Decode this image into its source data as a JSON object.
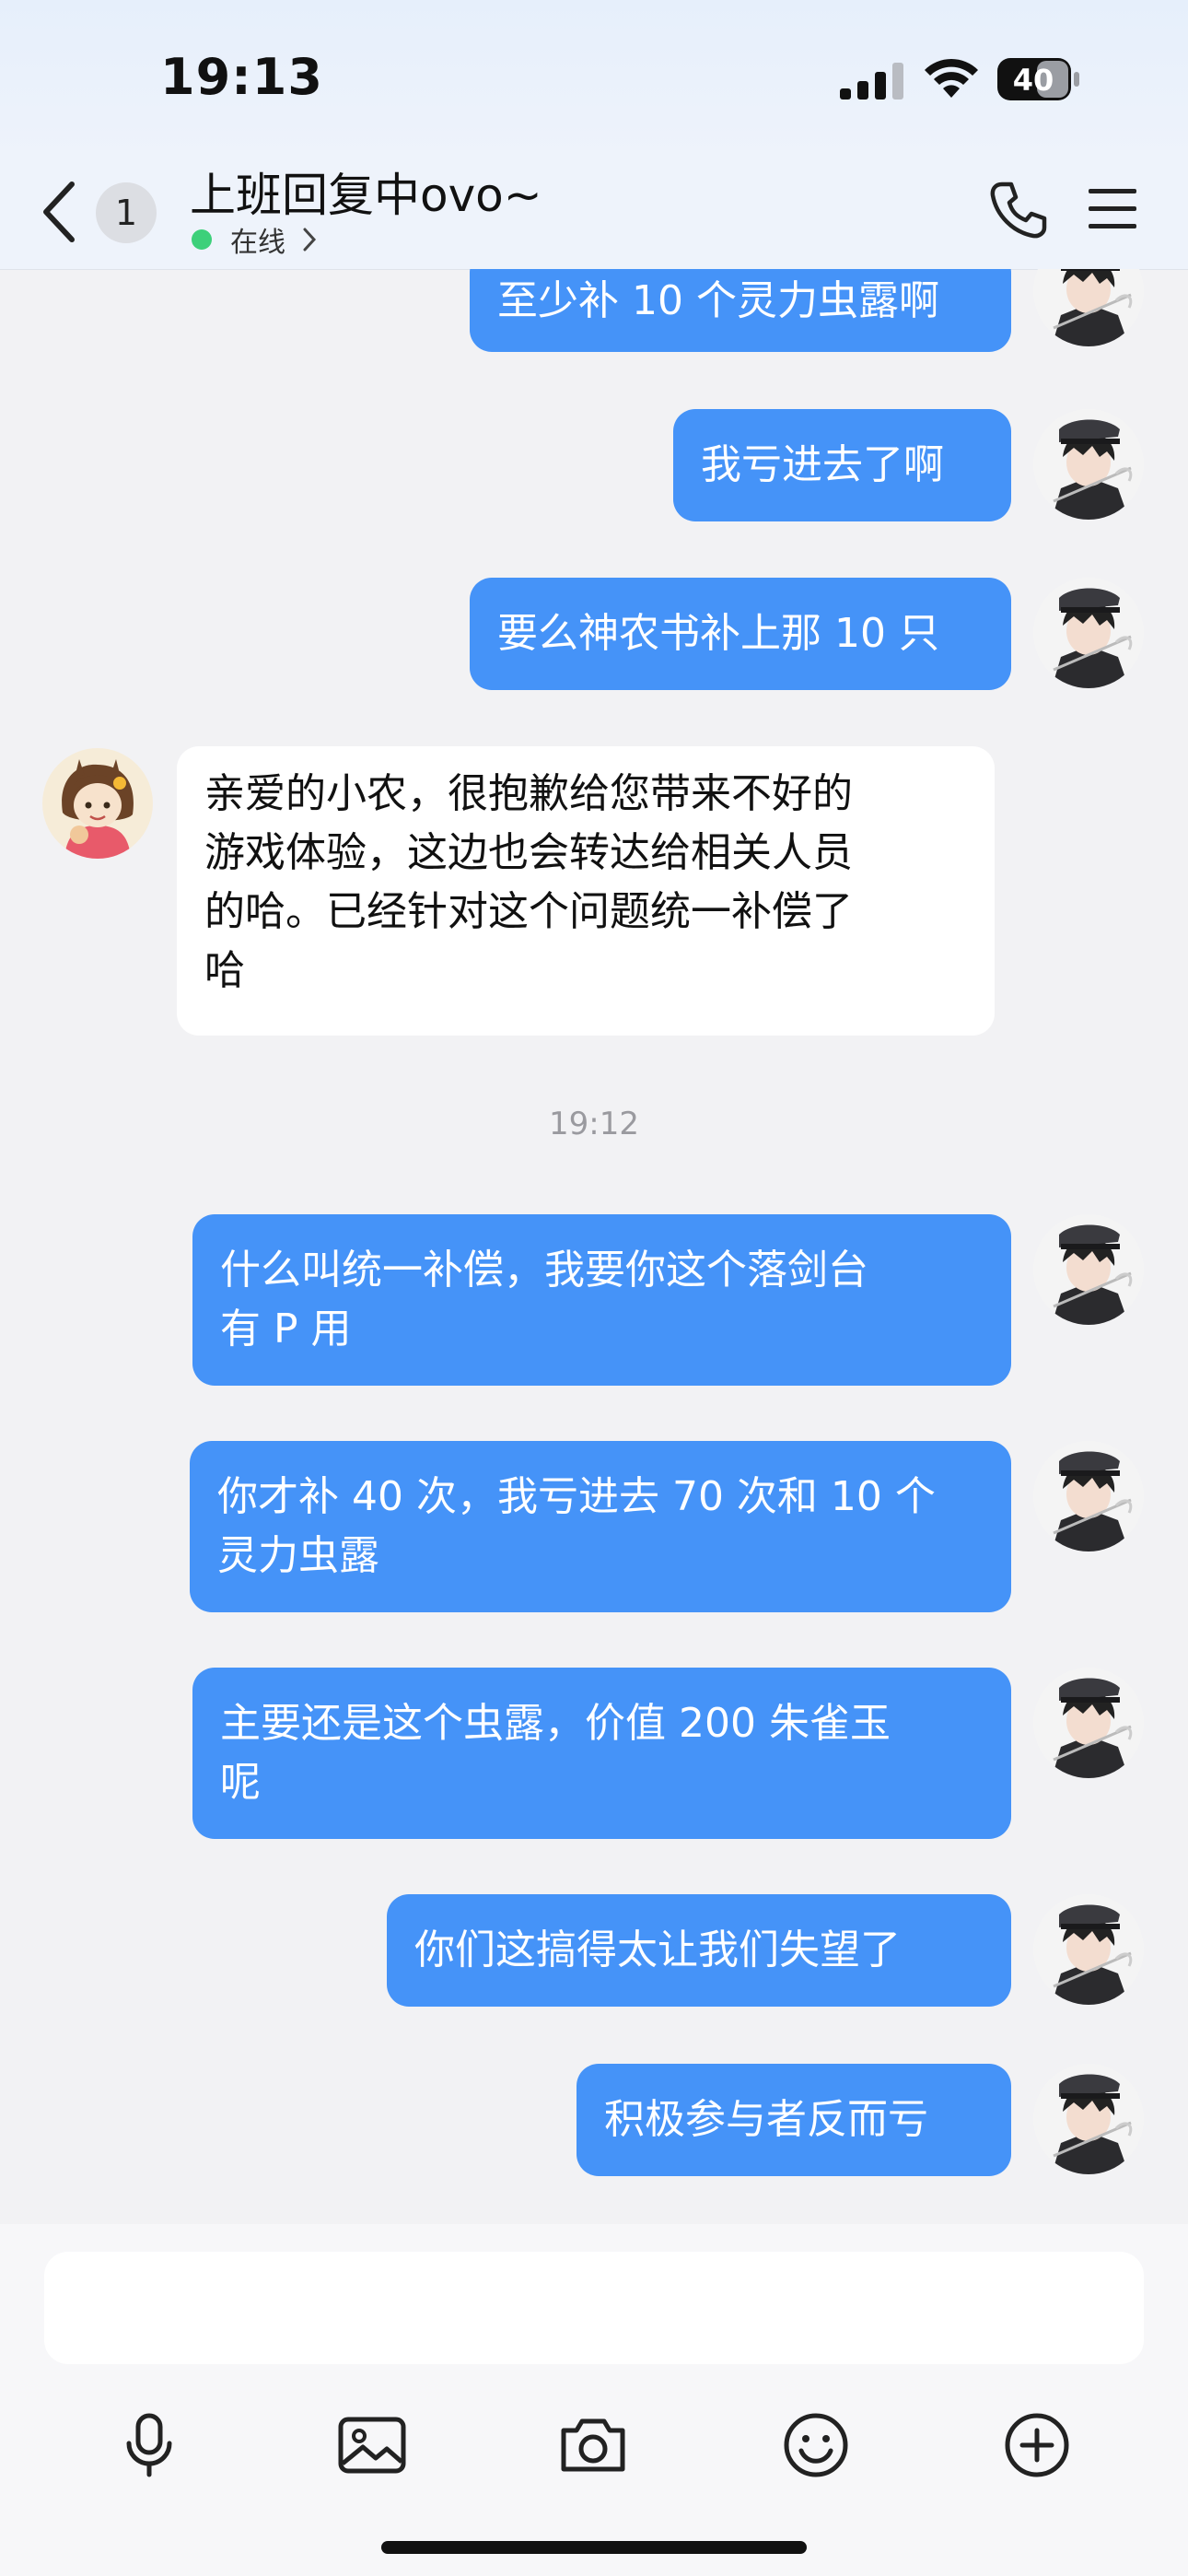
{
  "status_bar": {
    "time": "19:13",
    "battery": "40"
  },
  "header": {
    "unread_count": "1",
    "title": "上班回复中ovo~",
    "presence": "在线"
  },
  "messages": [
    {
      "side": "out",
      "text": "至少补 10 个灵力虫露啊"
    },
    {
      "side": "out",
      "text": "我亏进去了啊"
    },
    {
      "side": "out",
      "text": "要么神农书补上那 10 只"
    },
    {
      "side": "in",
      "lines": [
        "亲爱的小农，很抱歉给您带来不好的",
        "游戏体验，这边也会转达给相关人员",
        "的哈。已经针对这个问题统一补偿了",
        "哈"
      ]
    },
    {
      "side": "out",
      "lines": [
        "什么叫统一补偿，我要你这个落剑台",
        "有 P 用"
      ]
    },
    {
      "side": "out",
      "lines": [
        "你才补 40 次，我亏进去 70 次和 10 个",
        "灵力虫露"
      ]
    },
    {
      "side": "out",
      "lines": [
        "主要还是这个虫露，价值 200 朱雀玉",
        "呢"
      ]
    },
    {
      "side": "out",
      "text": "你们这搞得太让我们失望了"
    },
    {
      "side": "out",
      "text": "积极参与者反而亏"
    }
  ],
  "timestamp": "19:12",
  "composer": {
    "placeholder": ""
  },
  "toolbar_icons": [
    "microphone-icon",
    "image-icon",
    "camera-icon",
    "emoji-icon",
    "plus-icon"
  ],
  "colors": {
    "outgoing_bubble": "#4593f8",
    "incoming_bubble": "#ffffff",
    "online_dot": "#3dd07a"
  }
}
